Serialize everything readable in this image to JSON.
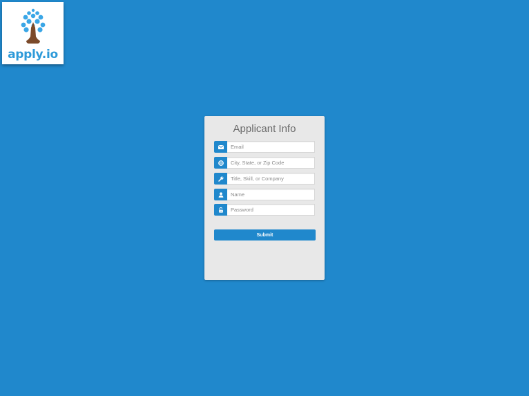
{
  "logo": {
    "text": "apply.io",
    "colors": {
      "bubbles": "#3aa6e6",
      "trunk": "#7b4a2a",
      "text": "#2d9ad9"
    }
  },
  "form": {
    "title": "Applicant Info",
    "fields": [
      {
        "icon": "envelope-icon",
        "placeholder": "Email",
        "value": ""
      },
      {
        "icon": "globe-icon",
        "placeholder": "City, State, or Zip Code",
        "value": ""
      },
      {
        "icon": "wrench-icon",
        "placeholder": "Title, Skill, or Company",
        "value": ""
      },
      {
        "icon": "user-icon",
        "placeholder": "Name",
        "value": ""
      },
      {
        "icon": "unlock-icon",
        "placeholder": "Password",
        "value": ""
      }
    ],
    "submit_label": "Submit"
  },
  "colors": {
    "background": "#2088cc",
    "card": "#e8e8e8",
    "accent": "#2088cc"
  }
}
